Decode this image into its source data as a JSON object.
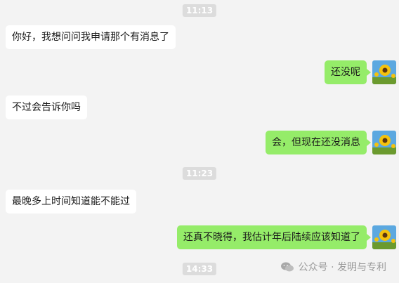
{
  "timestamps": [
    "11:13",
    "11:23",
    "14:33"
  ],
  "messages": [
    {
      "side": "left",
      "text": "你好，我想问问我申请那个有消息了"
    },
    {
      "side": "right",
      "text": "还没呢"
    },
    {
      "side": "left",
      "text": "不过会告诉你吗"
    },
    {
      "side": "right",
      "text": "会，但现在还没消息"
    },
    {
      "side": "left",
      "text": "最晚多上时间知道能不能过"
    },
    {
      "side": "right",
      "text": "还真不晓得，我估计年后陆续应该知道了"
    }
  ],
  "watermark": {
    "text": "公众号 · 发明与专利",
    "icon": "wechat-icon"
  },
  "colors": {
    "sent_bubble": "#95ec69",
    "received_bubble": "#ffffff",
    "background": "#f3f3f3",
    "timestamp_bg": "#dcdcdc"
  },
  "avatar_icon": "sunflower-avatar"
}
